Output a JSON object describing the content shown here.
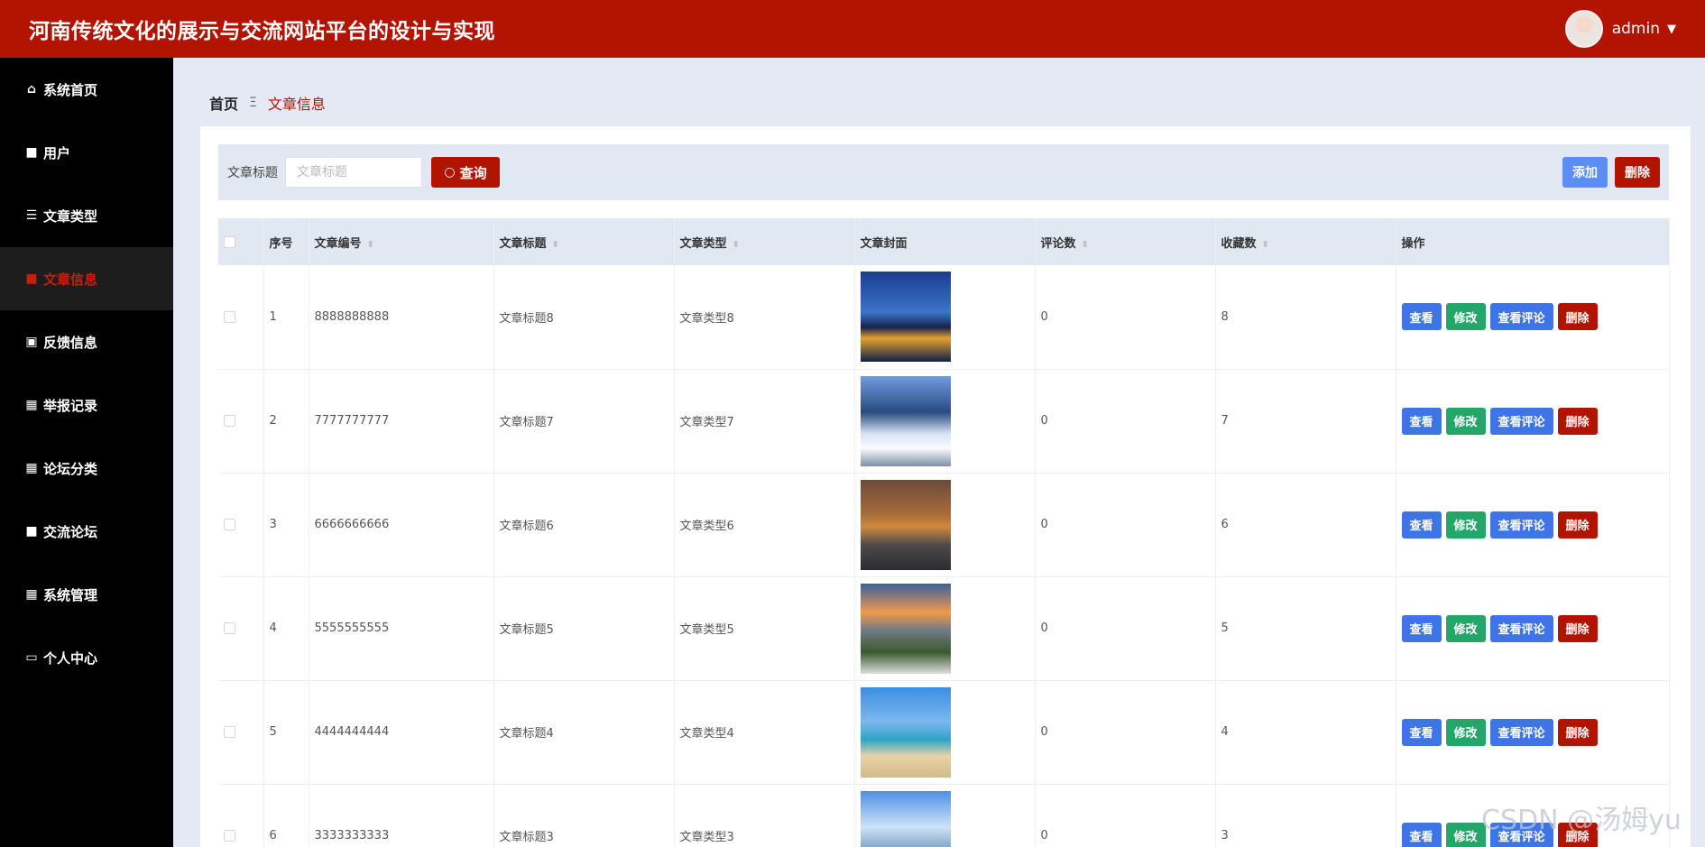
{
  "header": {
    "title": "河南传统文化的展示与交流网站平台的设计与实现",
    "username": "admin",
    "caret": "▼"
  },
  "sidebar": {
    "items": [
      {
        "icon": "home-icon",
        "glyph": "⌂",
        "label": "系统首页"
      },
      {
        "icon": "chat-icon",
        "glyph": "■",
        "label": "用户"
      },
      {
        "icon": "list-icon",
        "glyph": "☰",
        "label": "文章类型"
      },
      {
        "icon": "briefcase-icon",
        "glyph": "■",
        "label": "文章信息",
        "active": true
      },
      {
        "icon": "clipboard-icon",
        "glyph": "▣",
        "label": "反馈信息"
      },
      {
        "icon": "grid-icon",
        "glyph": "▦",
        "label": "举报记录"
      },
      {
        "icon": "grid-icon",
        "glyph": "▦",
        "label": "论坛分类"
      },
      {
        "icon": "comment-icon",
        "glyph": "■",
        "label": "交流论坛"
      },
      {
        "icon": "grid-icon",
        "glyph": "▦",
        "label": "系统管理"
      },
      {
        "icon": "card-icon",
        "glyph": "▭",
        "label": "个人中心"
      }
    ]
  },
  "breadcrumb": {
    "home": "首页",
    "separator": "Ξ",
    "current": "文章信息"
  },
  "toolbar": {
    "filter_label": "文章标题",
    "filter_placeholder": "文章标题",
    "search_label": "查询",
    "add_label": "添加",
    "delete_label": "删除"
  },
  "table": {
    "headers": {
      "index": "序号",
      "code": "文章编号",
      "title": "文章标题",
      "type": "文章类型",
      "cover": "文章封面",
      "comments": "评论数",
      "favorites": "收藏数",
      "actions": "操作"
    },
    "sortable": [
      "code",
      "title",
      "type",
      "comments",
      "favorites"
    ],
    "rows": [
      {
        "index": "1",
        "code": "8888888888",
        "title": "文章标题8",
        "type": "文章类型8",
        "comments": "0",
        "favorites": "8"
      },
      {
        "index": "2",
        "code": "7777777777",
        "title": "文章标题7",
        "type": "文章类型7",
        "comments": "0",
        "favorites": "7"
      },
      {
        "index": "3",
        "code": "6666666666",
        "title": "文章标题6",
        "type": "文章类型6",
        "comments": "0",
        "favorites": "6"
      },
      {
        "index": "4",
        "code": "5555555555",
        "title": "文章标题5",
        "type": "文章类型5",
        "comments": "0",
        "favorites": "5"
      },
      {
        "index": "5",
        "code": "4444444444",
        "title": "文章标题4",
        "type": "文章类型4",
        "comments": "0",
        "favorites": "4"
      },
      {
        "index": "6",
        "code": "3333333333",
        "title": "文章标题3",
        "type": "文章类型3",
        "comments": "0",
        "favorites": "3"
      }
    ],
    "row_actions": {
      "view": "查看",
      "edit": "修改",
      "comments": "查看评论",
      "delete": "删除"
    }
  },
  "watermark": "CSDN @汤姆yu",
  "colors": {
    "brand": "#b31402",
    "primary_blue": "#3e74e6",
    "success_green": "#23a768",
    "sidebar_bg": "#000000",
    "page_bg": "#e4e9f3"
  }
}
